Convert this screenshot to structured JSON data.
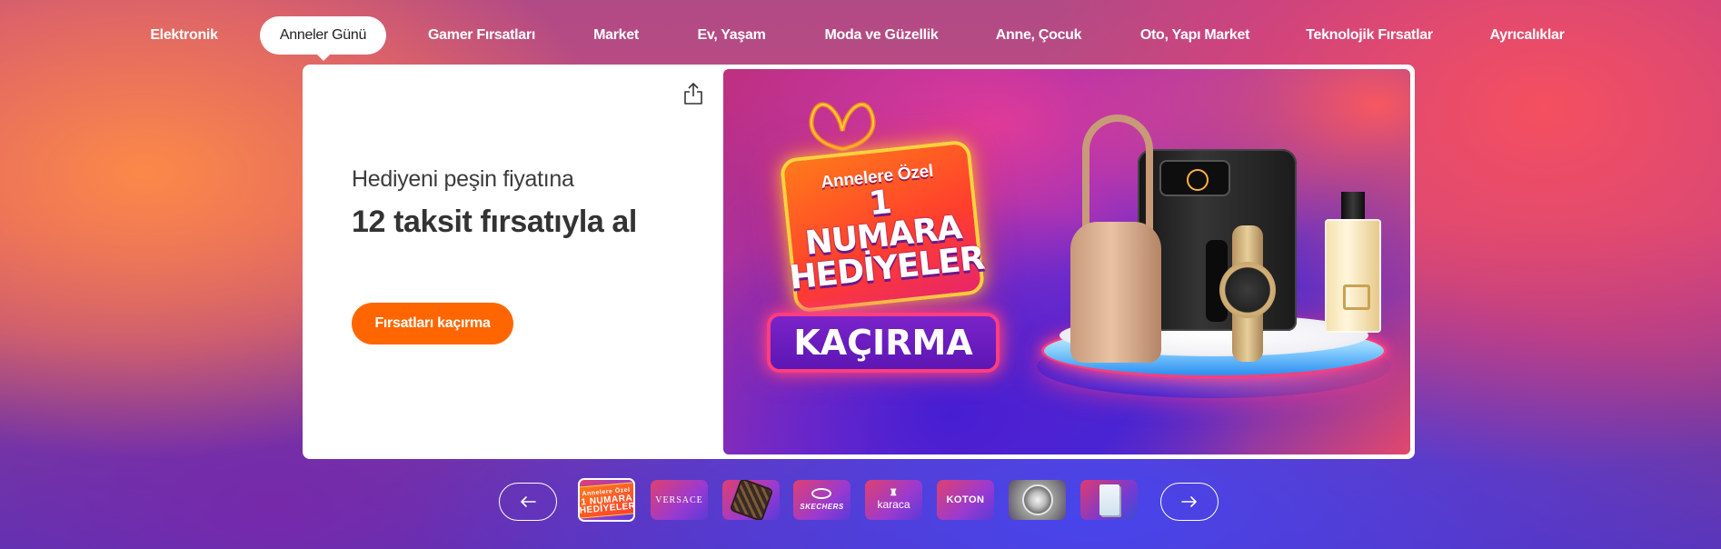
{
  "nav": {
    "items": [
      {
        "label": "Elektronik"
      },
      {
        "label": "Anneler Günü"
      },
      {
        "label": "Gamer Fırsatları"
      },
      {
        "label": "Market"
      },
      {
        "label": "Ev, Yaşam"
      },
      {
        "label": "Moda ve Güzellik"
      },
      {
        "label": "Anne, Çocuk"
      },
      {
        "label": "Oto, Yapı Market"
      },
      {
        "label": "Teknolojik Fırsatlar"
      },
      {
        "label": "Ayrıcalıklar"
      }
    ],
    "active_index": 1
  },
  "hero": {
    "subtitle": "Hediyeni peşin fiyatına",
    "headline": "12 taksit fırsatıyla al",
    "cta_label": "Fırsatları kaçırma",
    "share_icon": "share-icon",
    "banner": {
      "gift_line1": "Annelere Özel",
      "gift_line2": "1 NUMARA",
      "gift_line3": "HEDİYELER",
      "badge": "KAÇIRMA"
    }
  },
  "carousel": {
    "prev_icon": "arrow-left-icon",
    "next_icon": "arrow-right-icon",
    "thumbnails": [
      {
        "label_top": "Annelere Özel",
        "label_mid": "1 NUMARA",
        "label_bottom": "HEDİYELER"
      },
      {
        "label": "VERSACE"
      },
      {
        "label": ""
      },
      {
        "label": "SKECHERS"
      },
      {
        "label": "karaca"
      },
      {
        "label": "KOTON"
      },
      {
        "label": ""
      },
      {
        "label": ""
      }
    ],
    "active_index": 0
  },
  "colors": {
    "accent": "#ff6600",
    "neon_pink": "#ff3d7f",
    "gold": "#ffd23c"
  }
}
